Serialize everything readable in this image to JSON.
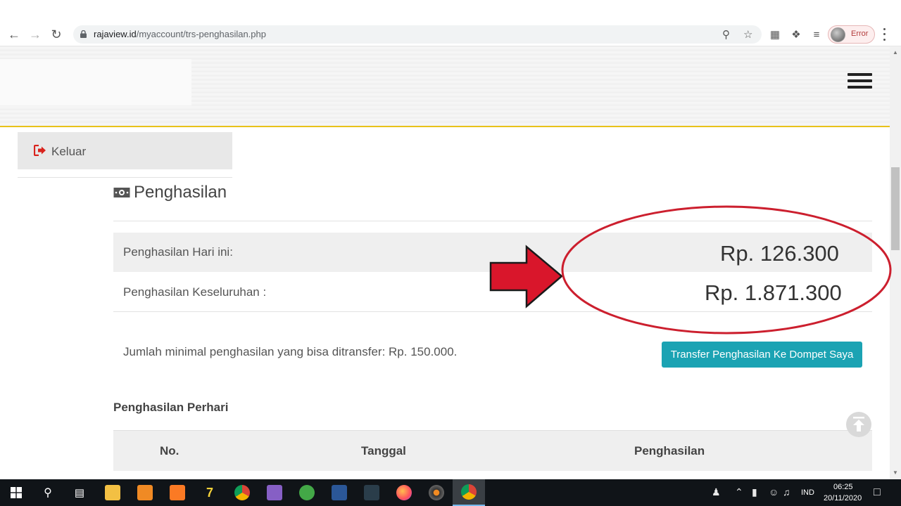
{
  "browser": {
    "url_domain": "rajaview.id",
    "url_path": "/myaccount/trs-penghasilan.php",
    "profile_status": "Error"
  },
  "sidebar": {
    "logout_label": "Keluar"
  },
  "main": {
    "title": "Penghasilan",
    "earnings": [
      {
        "label": "Penghasilan Hari ini:",
        "value": "Rp. 126.300"
      },
      {
        "label": "Penghasilan Keseluruhan :",
        "value": "Rp. 1.871.300"
      }
    ],
    "min_note": "Jumlah minimal penghasilan yang bisa ditransfer: Rp. 150.000.",
    "transfer_button": "Transfer Penghasilan Ke Dompet Saya",
    "daily_heading": "Penghasilan Perhari",
    "table_headers": [
      "No.",
      "Tanggal",
      "Penghasilan"
    ]
  },
  "colors": {
    "accent_teal": "#1ba3b3",
    "header_rule": "#e8c21a",
    "annotation_red": "#d0182a"
  },
  "taskbar": {
    "language": "IND",
    "time": "06:25",
    "date": "20/11/2020",
    "apps": [
      "file-explorer",
      "sublime-text",
      "xampp",
      "7zip",
      "chrome",
      "visual-studio",
      "evernote",
      "virtualbox",
      "filmora",
      "firefox",
      "media-player",
      "chrome-active"
    ]
  }
}
